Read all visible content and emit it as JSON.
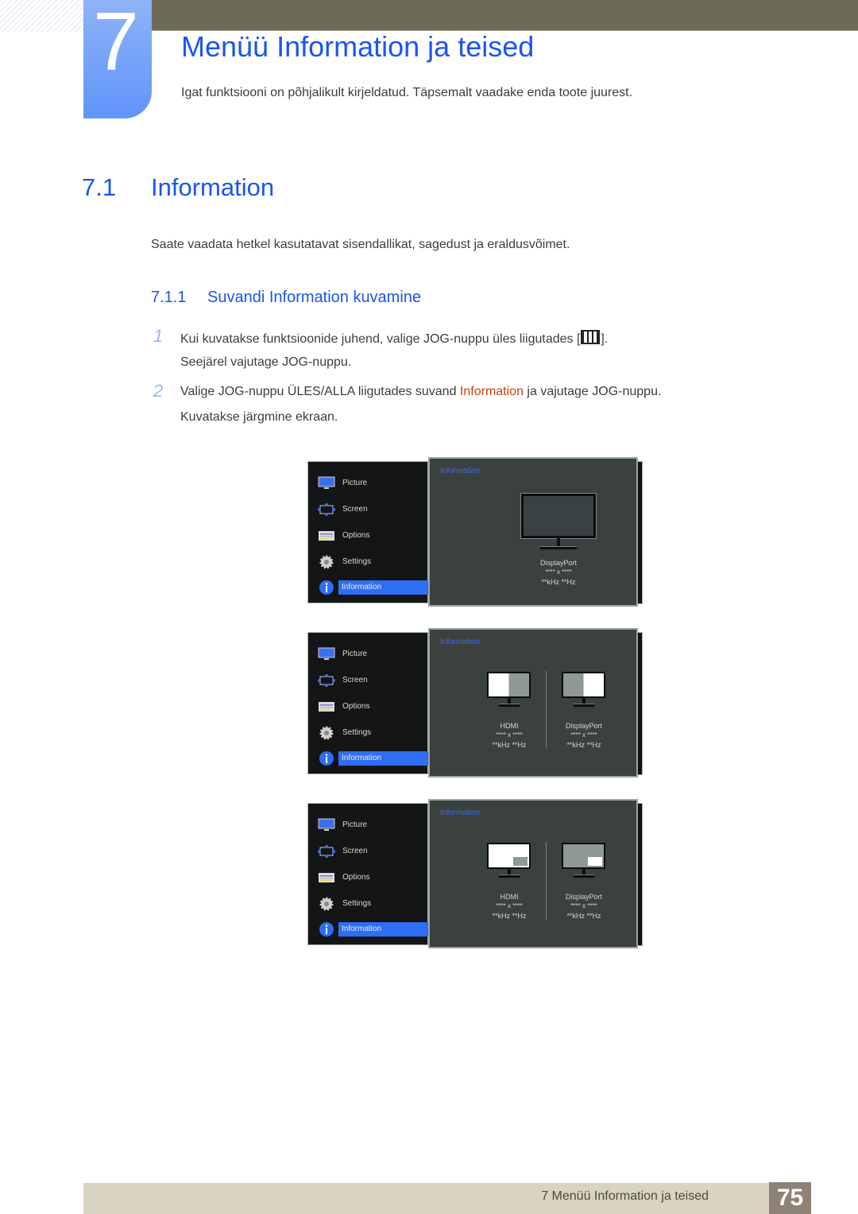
{
  "chapter": {
    "number": "7",
    "title": "Menüü Information ja teised",
    "intro": "Igat funktsiooni on põhjalikult kirjeldatud. Täpsemalt vaadake enda toote juurest."
  },
  "section": {
    "number": "7.1",
    "title": "Information",
    "text": "Saate vaadata hetkel kasutatavat sisendallikat, sagedust ja eraldusvõimet."
  },
  "subsection": {
    "number": "7.1.1",
    "title": "Suvandi Information kuvamine"
  },
  "steps": [
    {
      "num": "1",
      "line1_pre": "Kui kuvatakse funktsioonide juhend, valige JOG-nuppu üles liigutades [",
      "icon": "jog-menu-icon",
      "line1_post": "].",
      "line2": "Seejärel vajutage JOG-nuppu."
    },
    {
      "num": "2",
      "line1_pre": "Valige JOG-nuppu ÜLES/ALLA liigutades suvand ",
      "highlight": "Information",
      "line1_post": " ja vajutage JOG-nuppu.",
      "line2": "Kuvatakse järgmine ekraan."
    }
  ],
  "osd": {
    "menu": [
      {
        "label": "Picture",
        "icon": "picture-icon"
      },
      {
        "label": "Screen",
        "icon": "screen-icon"
      },
      {
        "label": "Options",
        "icon": "options-icon"
      },
      {
        "label": "Settings",
        "icon": "settings-icon"
      },
      {
        "label": "Information",
        "icon": "information-icon",
        "selected": true
      }
    ],
    "panel_title": "Information",
    "screens": [
      {
        "mode": "single",
        "sources": [
          {
            "name": "DisplayPort",
            "resolution": "**** x ****",
            "frequency": "**kHz **Hz"
          }
        ]
      },
      {
        "mode": "pbp",
        "sources": [
          {
            "name": "HDMI",
            "resolution": "**** x ****",
            "frequency": "**kHz **Hz"
          },
          {
            "name": "DisplayPort",
            "resolution": "**** x ****",
            "frequency": "**kHz **Hz"
          }
        ]
      },
      {
        "mode": "pip",
        "sources": [
          {
            "name": "HDMI",
            "resolution": "**** x ****",
            "frequency": "**kHz **Hz"
          },
          {
            "name": "DisplayPort",
            "resolution": "**** x ****",
            "frequency": "**kHz **Hz"
          }
        ]
      }
    ]
  },
  "footer": {
    "text": "7 Menüü Information ja teised",
    "page": "75"
  },
  "colors": {
    "heading_blue": "#1a55f0",
    "highlight_orange": "#c8410e",
    "osd_selected": "#2f6ef4",
    "topbar": "#6d6b58",
    "footer_bg": "#d9d4c0",
    "page_badge": "#8d8274"
  }
}
